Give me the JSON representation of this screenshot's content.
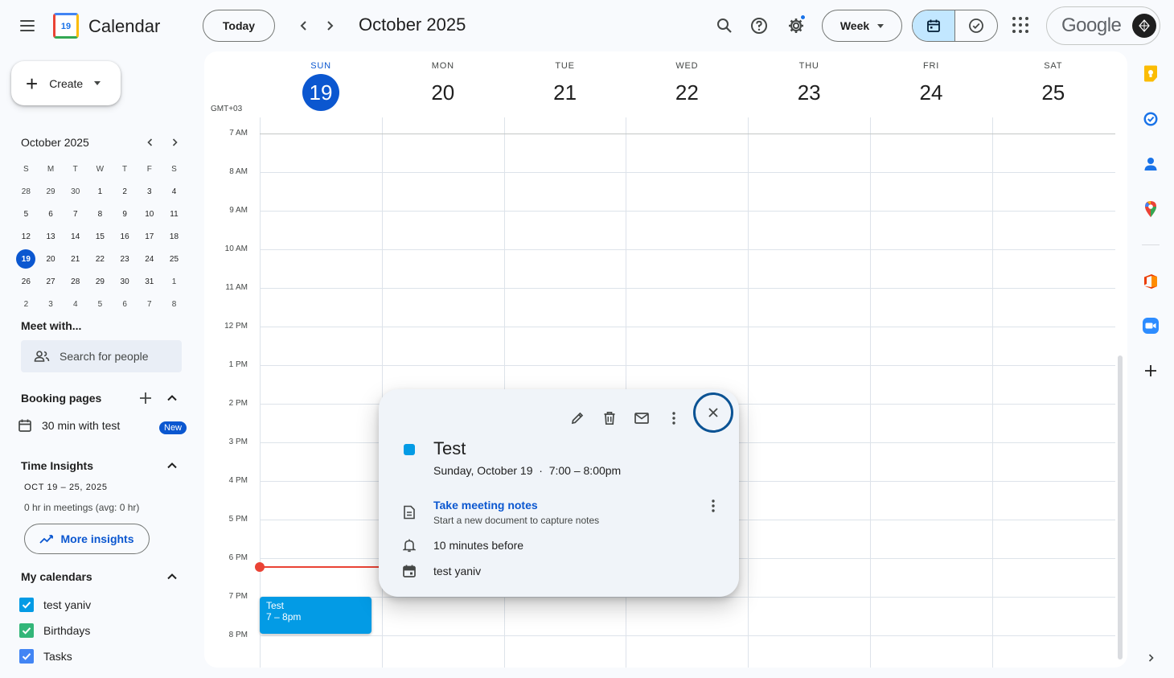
{
  "header": {
    "app_title": "Calendar",
    "logo_text": "19",
    "today_label": "Today",
    "month_title": "October 2025",
    "view_label": "Week",
    "account_brand": "Google"
  },
  "sidebar": {
    "create_label": "Create",
    "mini_cal": {
      "title": "October 2025",
      "weekday_headers": [
        "S",
        "M",
        "T",
        "W",
        "T",
        "F",
        "S"
      ],
      "weeks": [
        [
          "28",
          "29",
          "30",
          "1",
          "2",
          "3",
          "4"
        ],
        [
          "5",
          "6",
          "7",
          "8",
          "9",
          "10",
          "11"
        ],
        [
          "12",
          "13",
          "14",
          "15",
          "16",
          "17",
          "18"
        ],
        [
          "19",
          "20",
          "21",
          "22",
          "23",
          "24",
          "25"
        ],
        [
          "26",
          "27",
          "28",
          "29",
          "30",
          "31",
          "1"
        ],
        [
          "2",
          "3",
          "4",
          "5",
          "6",
          "7",
          "8"
        ]
      ],
      "selected": "19"
    },
    "meet_with_label": "Meet with...",
    "search_people_placeholder": "Search for people",
    "booking_pages_label": "Booking pages",
    "booking_item_label": "30 min with test",
    "new_badge": "New",
    "time_insights_label": "Time Insights",
    "time_insights_range": "OCT 19 – 25, 2025",
    "time_insights_meetings": "0 hr in meetings (avg: 0 hr)",
    "more_insights_label": "More insights",
    "my_calendars_label": "My calendars",
    "calendars": [
      {
        "name": "test yaniv",
        "color": "#039be5"
      },
      {
        "name": "Birthdays",
        "color": "#33b679"
      },
      {
        "name": "Tasks",
        "color": "#4285f4"
      }
    ]
  },
  "week": {
    "timezone": "GMT+03",
    "days": [
      {
        "name": "SUN",
        "num": "19",
        "today": true
      },
      {
        "name": "MON",
        "num": "20"
      },
      {
        "name": "TUE",
        "num": "21"
      },
      {
        "name": "WED",
        "num": "22"
      },
      {
        "name": "THU",
        "num": "23"
      },
      {
        "name": "FRI",
        "num": "24"
      },
      {
        "name": "SAT",
        "num": "25"
      }
    ],
    "hours": [
      "7 AM",
      "8 AM",
      "9 AM",
      "10 AM",
      "11 AM",
      "12 PM",
      "1 PM",
      "2 PM",
      "3 PM",
      "4 PM",
      "5 PM",
      "6 PM",
      "7 PM",
      "8 PM"
    ]
  },
  "event": {
    "title": "Test",
    "time": "7 – 8pm",
    "color": "#039be5"
  },
  "popup": {
    "title": "Test",
    "when": "Sunday, October 19  ·  7:00 – 8:00pm",
    "notes_link": "Take meeting notes",
    "notes_sub": "Start a new document to capture notes",
    "reminder": "10 minutes before",
    "calendar": "test yaniv"
  },
  "colors": {
    "accent": "#0b57d0",
    "now_line": "#ea4335",
    "event": "#039be5"
  }
}
